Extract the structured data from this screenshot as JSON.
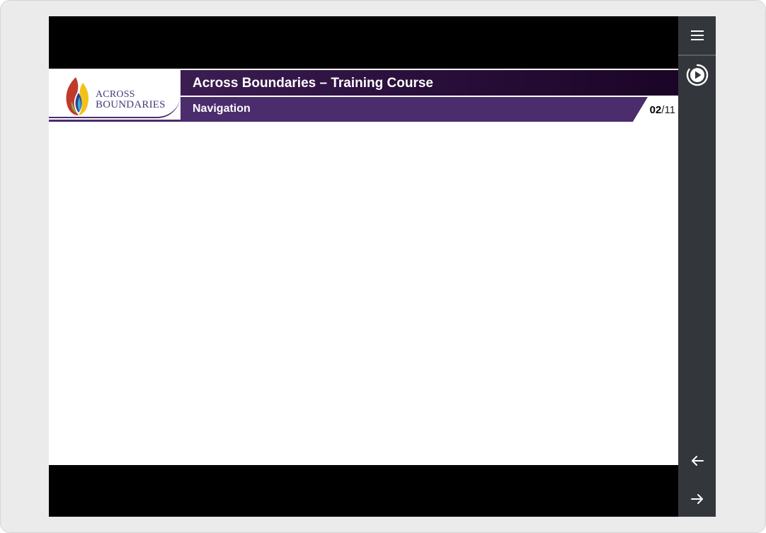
{
  "course": {
    "logo_line1": "ACROSS",
    "logo_line2": "BOUNDARIES",
    "title": "Across Boundaries – Training Course",
    "section": "Navigation",
    "page_current": "02",
    "page_separator": "/",
    "page_total": "11"
  },
  "sidebar": {
    "buttons": [
      {
        "name": "menu-icon"
      },
      {
        "name": "play-icon"
      },
      {
        "name": "arrow-left-icon"
      },
      {
        "name": "arrow-right-icon"
      }
    ]
  },
  "colors": {
    "frame": "#ebebeb",
    "sidebar": "#33373b",
    "title_bar": "#2a0f3c",
    "section_bar": "#4b2c6c",
    "logo_text": "#4a3a78"
  }
}
